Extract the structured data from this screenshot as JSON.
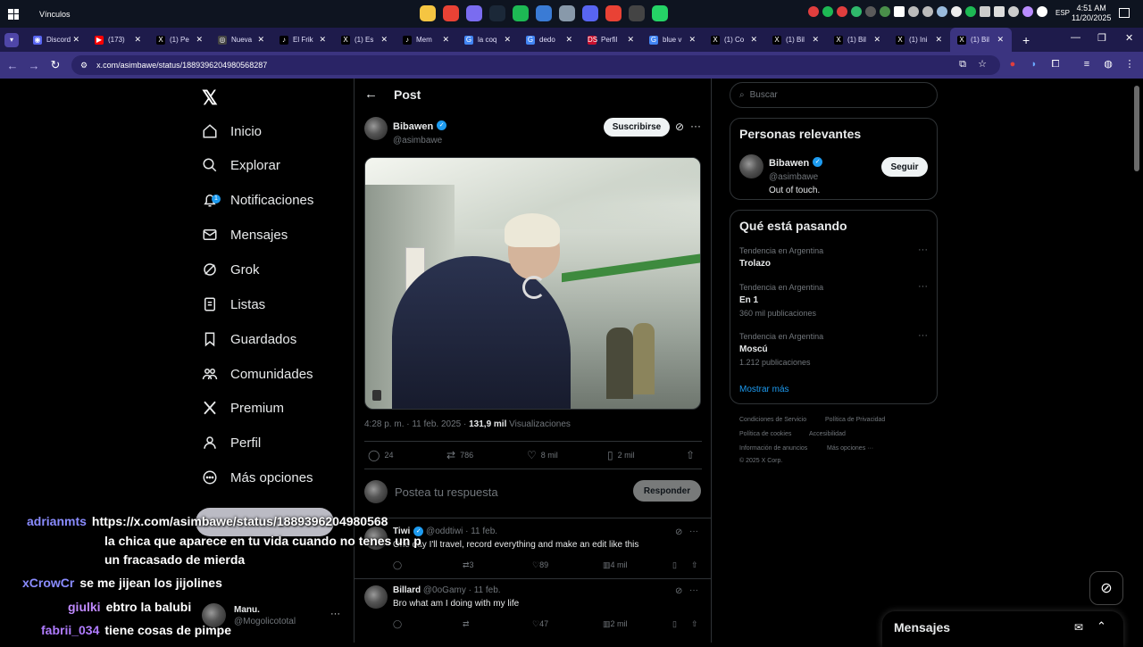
{
  "taskbar": {
    "links_label": "Vínculos",
    "apps": [
      {
        "icon": "folder-icon",
        "color": "#f5c542"
      },
      {
        "icon": "chrome-icon",
        "color": "#e94235"
      },
      {
        "icon": "copilot-icon",
        "color": "#7a6cf0"
      },
      {
        "icon": "steam-icon",
        "color": "#1b2838"
      },
      {
        "icon": "spotify-icon",
        "color": "#1db954"
      },
      {
        "icon": "store-icon",
        "color": "#3a7bd5"
      },
      {
        "icon": "app-icon",
        "color": "#8899aa"
      },
      {
        "icon": "discord-icon",
        "color": "#5865f2"
      },
      {
        "icon": "chrome-alt-icon",
        "color": "#e94235"
      },
      {
        "icon": "obs-icon",
        "color": "#444444"
      },
      {
        "icon": "whatsapp-icon",
        "color": "#25d366"
      }
    ],
    "language": "ESP",
    "time": "4:51 AM",
    "date": "11/20/2025"
  },
  "browser": {
    "tabs": [
      {
        "label": "Discord",
        "color": "#5865f2",
        "glyph": "◉"
      },
      {
        "label": "(173)",
        "color": "#ff0000",
        "glyph": "▶"
      },
      {
        "label": "(1) Pe",
        "color": "#000000",
        "glyph": "X"
      },
      {
        "label": "Nueva",
        "color": "#444444",
        "glyph": "◎"
      },
      {
        "label": "El Frik",
        "color": "#000000",
        "glyph": "♪"
      },
      {
        "label": "(1) Es",
        "color": "#000000",
        "glyph": "X"
      },
      {
        "label": "Mem",
        "color": "#000000",
        "glyph": "♪"
      },
      {
        "label": "la coq",
        "color": "#4285f4",
        "glyph": "G"
      },
      {
        "label": "dedo",
        "color": "#4285f4",
        "glyph": "G"
      },
      {
        "label": "Perfil",
        "color": "#c8102e",
        "glyph": "DS"
      },
      {
        "label": "blue v",
        "color": "#4285f4",
        "glyph": "G"
      },
      {
        "label": "(1) Co",
        "color": "#000000",
        "glyph": "X"
      },
      {
        "label": "(1) Bil",
        "color": "#000000",
        "glyph": "X"
      },
      {
        "label": "(1) Bil",
        "color": "#000000",
        "glyph": "X"
      },
      {
        "label": "(1) Ini",
        "color": "#000000",
        "glyph": "X"
      },
      {
        "label": "(1) Bil",
        "color": "#000000",
        "glyph": "X",
        "active": true
      }
    ],
    "url": "x.com/asimbawe/status/1889396204980568287"
  },
  "nav": {
    "items": [
      {
        "label": "Inicio",
        "icon": "home-icon"
      },
      {
        "label": "Explorar",
        "icon": "search-icon"
      },
      {
        "label": "Notificaciones",
        "icon": "bell-icon",
        "badge": "1"
      },
      {
        "label": "Mensajes",
        "icon": "envelope-icon"
      },
      {
        "label": "Grok",
        "icon": "grok-icon"
      },
      {
        "label": "Listas",
        "icon": "list-icon"
      },
      {
        "label": "Guardados",
        "icon": "bookmark-icon"
      },
      {
        "label": "Comunidades",
        "icon": "communities-icon"
      },
      {
        "label": "Premium",
        "icon": "x-premium-icon"
      },
      {
        "label": "Perfil",
        "icon": "person-icon"
      },
      {
        "label": "Más opciones",
        "icon": "more-circle-icon"
      }
    ]
  },
  "post": {
    "header_title": "Post",
    "author_name": "Bibawen",
    "author_handle": "@asimbawe",
    "subscribe_label": "Suscribirse",
    "time": "4:28 p. m. · 11 feb. 2025 · ",
    "views_count": "131,9 mil",
    "views_label": " Visualizaciones",
    "replies": "24",
    "reposts": "786",
    "likes": "8 mil",
    "bookmarks": "2 mil",
    "reply_placeholder": "Postea tu respuesta",
    "reply_button": "Responder"
  },
  "replies": [
    {
      "name": "Tiwi",
      "verified": true,
      "handle": "@oddtiwi · 11 feb.",
      "text": "One day I'll travel, record everything and make an edit like this",
      "reposts": "3",
      "likes": "89",
      "views": "4 mil"
    },
    {
      "name": "Billard",
      "verified": false,
      "handle": "@0oGamy · 11 feb.",
      "text": "Bro what am I doing with my life",
      "reposts": "",
      "likes": "47",
      "views": "2 mil"
    }
  ],
  "sidebar": {
    "search_placeholder": "Buscar",
    "relevant_title": "Personas relevantes",
    "relevant_name": "Bibawen",
    "relevant_handle": "@asimbawe",
    "relevant_bio": "Out of touch.",
    "follow_label": "Seguir",
    "trends_title": "Qué está pasando",
    "trends": [
      {
        "context": "Tendencia en Argentina",
        "name": "Trolazo",
        "count": ""
      },
      {
        "context": "Tendencia en Argentina",
        "name": "En 1",
        "count": "360 mil publicaciones"
      },
      {
        "context": "Tendencia en Argentina",
        "name": "Moscú",
        "count": "1.212 publicaciones"
      }
    ],
    "show_more": "Mostrar más",
    "footer": [
      "Condiciones de Servicio",
      "Política de Privacidad",
      "Política de cookies",
      "Accesibilidad",
      "Información de anuncios",
      "Más opciones ···",
      "© 2025 X Corp."
    ],
    "messages_title": "Mensajes"
  },
  "chat": {
    "lines": [
      {
        "user": "adrianmts",
        "color": "#8a8cff",
        "msg": "https://x.com/asimbawe/status/1889396204980568"
      },
      {
        "user": "",
        "color": "#ffffff",
        "msg": "la chica que aparece en tu vida cuando no tenes un p"
      },
      {
        "user": "",
        "color": "#ffffff",
        "msg": "un fracasado de mierda"
      },
      {
        "user": "xCrowCr",
        "color": "#8a8cff",
        "msg": "se me jijean los jijolines"
      },
      {
        "user": "giulki",
        "color": "#c08aff",
        "msg": "ebtro la balubi"
      },
      {
        "user": "fabrii_034",
        "color": "#b07cff",
        "msg": "tiene cosas de pimpe"
      }
    ],
    "manu_name": "Manu.",
    "manu_handle": "@Mogolicototal"
  }
}
